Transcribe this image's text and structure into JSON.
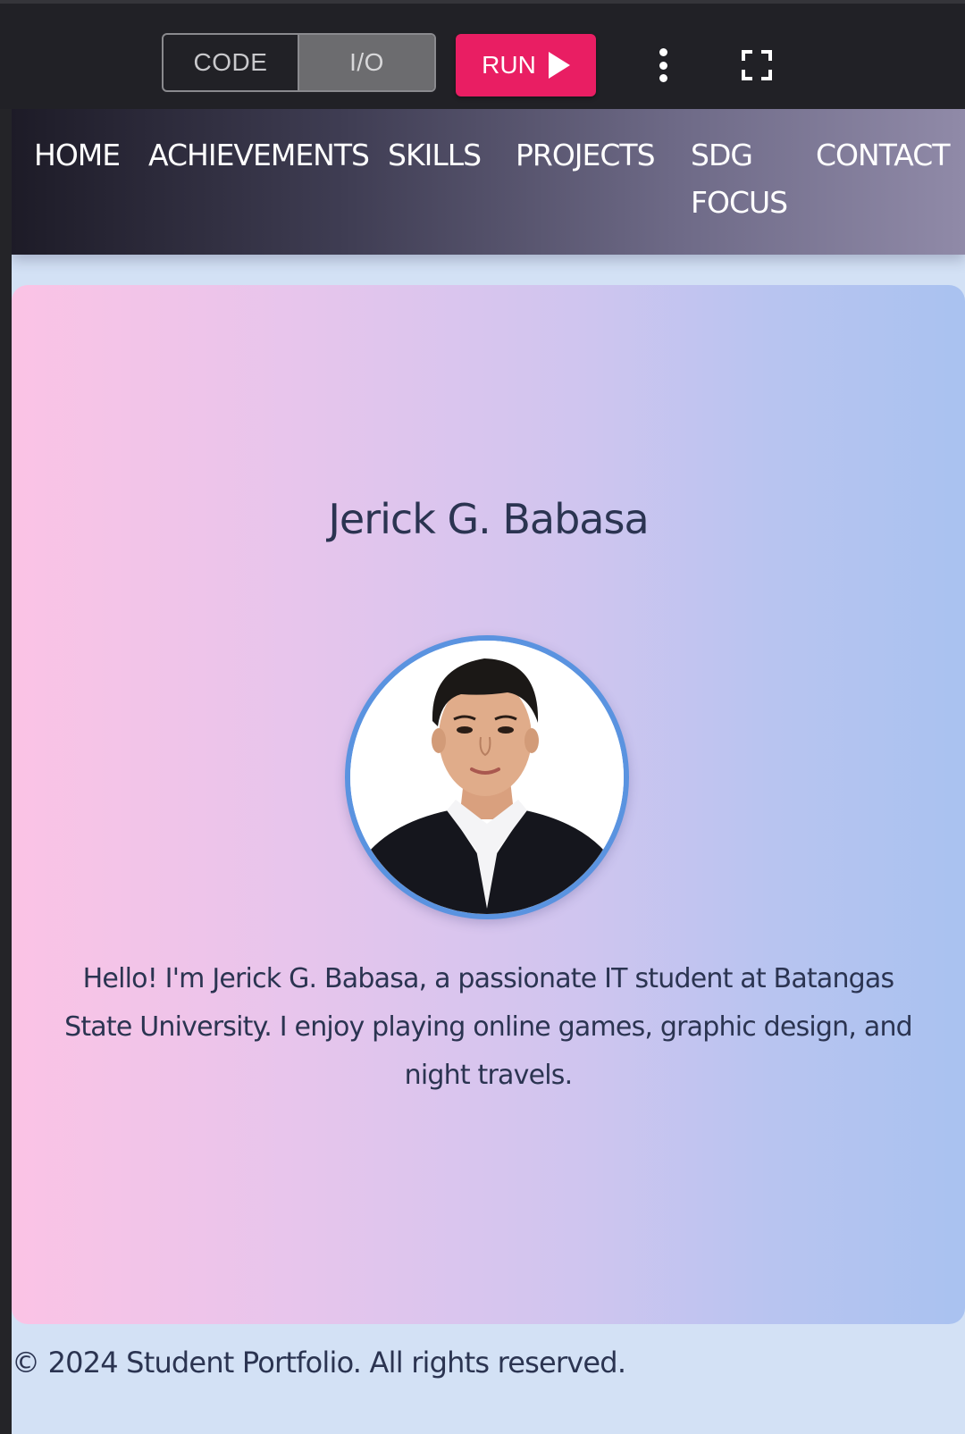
{
  "toolbar": {
    "code_label": "CODE",
    "io_label": "I/O",
    "run_label": "RUN",
    "icons": {
      "run": "play-icon",
      "more": "more-vertical-icon",
      "fullscreen": "fullscreen-icon"
    },
    "run_color": "#e91e63"
  },
  "nav": {
    "items": [
      {
        "label": "HOME"
      },
      {
        "label": "ACHIEVEMENTS"
      },
      {
        "label": "SKILLS"
      },
      {
        "label": "PROJECTS"
      },
      {
        "label": "SDG FOCUS"
      },
      {
        "label": "CONTACT"
      }
    ]
  },
  "hero": {
    "name": "Jerick G. Babasa",
    "bio": "Hello! I'm Jerick G. Babasa, a passionate IT student at Batangas State University. I enjoy playing online games, graphic design, and night travels.",
    "avatar_border_color": "#5a93e0"
  },
  "footer": {
    "text": "© 2024 Student Portfolio. All rights reserved."
  }
}
